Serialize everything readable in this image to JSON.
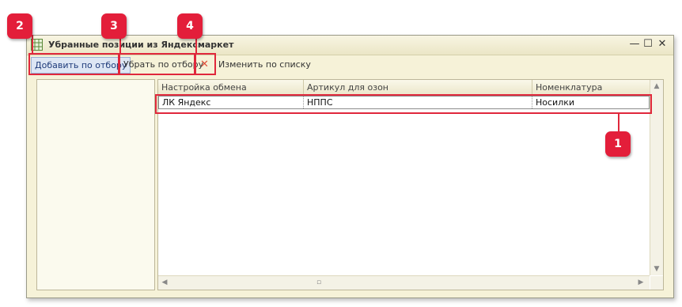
{
  "window": {
    "title": "Убранные позиции из Яндексмаркет",
    "controls": {
      "minimize": "—",
      "maximize": "☐",
      "close": "✕"
    }
  },
  "toolbar": {
    "add_filter": "Добавить по отбору",
    "remove_filter": "Убрать по отбору",
    "delete_icon": "✕",
    "change_list": "Изменить по списку"
  },
  "table": {
    "columns": [
      "Настройка обмена",
      "Артикул для озон",
      "Номенклатура"
    ],
    "rows": [
      [
        "ЛК Яндекс",
        "НППС",
        "Носилки"
      ]
    ]
  },
  "annotations": [
    "1",
    "2",
    "3",
    "4"
  ],
  "colors": {
    "annotation": "#e31e3a",
    "window_bg": "#f6f2d8",
    "active_button_bg": "#dde6f4"
  }
}
